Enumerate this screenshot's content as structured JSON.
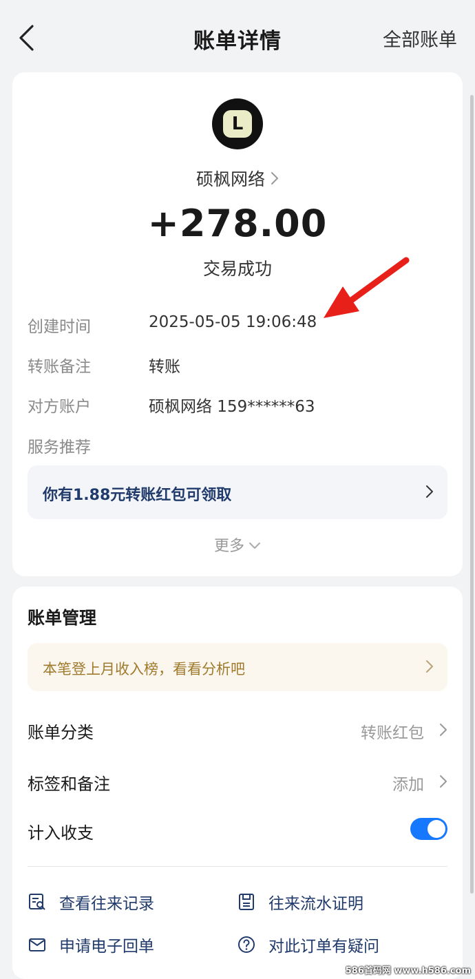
{
  "header": {
    "title": "账单详情",
    "right_link": "全部账单"
  },
  "bill": {
    "avatar_letter": "L",
    "merchant": "硕枫网络",
    "amount": "+278.00",
    "status": "交易成功",
    "rows": [
      {
        "label": "创建时间",
        "value": "2025-05-05 19:06:48"
      },
      {
        "label": "转账备注",
        "value": "转账"
      },
      {
        "label": "对方账户",
        "value": "硕枫网络 159******63"
      },
      {
        "label": "服务推荐",
        "value": ""
      }
    ],
    "promo": "你有1.88元转账红包可领取",
    "more": "更多"
  },
  "manage": {
    "title": "账单管理",
    "notice": "本笔登上月收入榜，看看分析吧",
    "category_label": "账单分类",
    "category_value": "转账红包",
    "tag_label": "标签和备注",
    "tag_value": "添加",
    "count_label": "计入收支",
    "count_enabled": true,
    "actions": [
      {
        "label": "查看往来记录",
        "icon": "search-record-icon"
      },
      {
        "label": "往来流水证明",
        "icon": "document-icon"
      },
      {
        "label": "申请电子回单",
        "icon": "mail-icon"
      },
      {
        "label": "对此订单有疑问",
        "icon": "question-icon"
      }
    ]
  },
  "watermark": "586首码网 www.h586.com",
  "colors": {
    "accent": "#1677ff",
    "link": "#1f3a6b",
    "annotation_arrow": "#e8201a",
    "notice_text": "#a07a2c"
  }
}
